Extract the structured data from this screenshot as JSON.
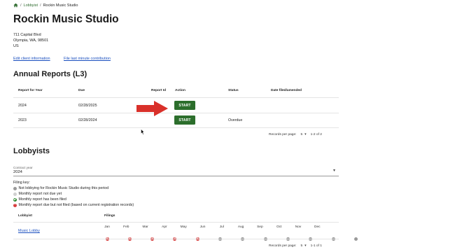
{
  "breadcrumb": {
    "home_icon": "home-icon",
    "separator": "/",
    "lobbyist_link": "Lobbyist",
    "current": "Rockin Music Studio"
  },
  "page_title": "Rockin Music Studio",
  "address": {
    "line1": "711 Capital Blvd",
    "line2": "Olympia, WA, 98501",
    "line3": "US"
  },
  "links": {
    "edit_client": "Edit client information",
    "file_contribution": "File last minute contribution"
  },
  "annual_reports": {
    "title": "Annual Reports (L3)",
    "columns": [
      "Report for Year",
      "Due",
      "Report Id",
      "Action",
      "Status",
      "Date filed/amended"
    ],
    "rows": [
      {
        "year": "2024",
        "due": "02/28/2025",
        "report_id": "",
        "action": "START",
        "status": "",
        "date_filed": ""
      },
      {
        "year": "2023",
        "due": "02/28/2024",
        "report_id": "",
        "action": "START",
        "status": "Overdue",
        "date_filed": ""
      }
    ],
    "pager": {
      "label": "Records per page:",
      "per_page": "5",
      "range": "1-2 of 2"
    }
  },
  "lobbyists": {
    "title": "Lobbyists",
    "contract_year_label": "Contract year",
    "contract_year_value": "2024",
    "filing_key_title": "Filing key:",
    "filing_key": [
      {
        "icon": "gray-circle-icon",
        "text": "Not lobbying for Rockin Music Studio during this period"
      },
      {
        "icon": "light-gray-circle-icon",
        "text": "Monthly report not due yet"
      },
      {
        "icon": "green-check-icon",
        "text": "Monthly report has been filed"
      },
      {
        "icon": "red-x-icon",
        "text": "Monthly report due but not filed (based on current registration records)"
      }
    ],
    "columns": {
      "lobbyist": "Lobbyist",
      "filings": "Filings"
    },
    "months": [
      "Jan",
      "Feb",
      "Mar",
      "Apr",
      "May",
      "Jun",
      "Jul",
      "Aug",
      "Sep",
      "Oct",
      "Nov",
      "Dec"
    ],
    "rows": [
      {
        "name": "Music Lobby",
        "statuses": [
          "due-not-filed",
          "due-not-filed",
          "due-not-filed",
          "due-not-filed",
          "due-not-filed",
          "not-lobbying",
          "not-lobbying",
          "not-lobbying",
          "not-lobbying",
          "not-lobbying",
          "not-lobbying",
          "not-lobbying"
        ]
      }
    ],
    "pager": {
      "label": "Records per page:",
      "per_page": "5",
      "range": "1-1 of 1"
    }
  },
  "colors": {
    "accent_green": "#2c6e2c",
    "link_blue": "#1a4fbf",
    "arrow_red": "#d9302a",
    "status_red": "#d63c3c",
    "status_gray": "#9a9a9a"
  }
}
